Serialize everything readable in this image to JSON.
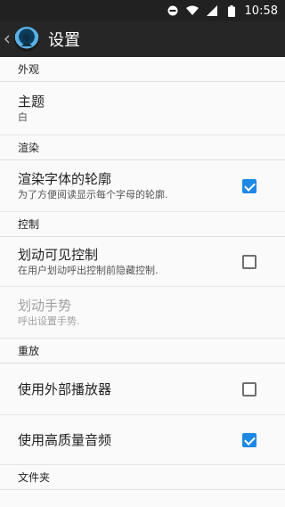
{
  "status": {
    "time": "10:58"
  },
  "app": {
    "title": "设置"
  },
  "sections": {
    "appearance": "外观",
    "render": "渲染",
    "control": "控制",
    "playback": "重放",
    "folder": "文件夹"
  },
  "items": {
    "theme": {
      "title": "主题",
      "value": "白"
    },
    "outline": {
      "title": "渲染字体的轮廓",
      "summary": "为了方便阅读显示每个字母的轮廓.",
      "checked": true
    },
    "swipe_visible": {
      "title": "划动可见控制",
      "summary": "在用户划动呼出控制前隐藏控制.",
      "checked": false
    },
    "swipe_gesture": {
      "title": "划动手势",
      "summary": "呼出设置手势."
    },
    "external_player": {
      "title": "使用外部播放器",
      "checked": false
    },
    "hq_audio": {
      "title": "使用高质量音频",
      "checked": true
    }
  },
  "colors": {
    "accent": "#1e88e5",
    "appbar": "#262626",
    "statusbar": "#212121"
  },
  "icons": {
    "back": "chevron-left-icon",
    "logo": "app-logo-icon",
    "wifi": "wifi-icon",
    "signal": "signal-icon",
    "battery": "battery-icon",
    "dnd": "do-not-disturb-icon"
  }
}
